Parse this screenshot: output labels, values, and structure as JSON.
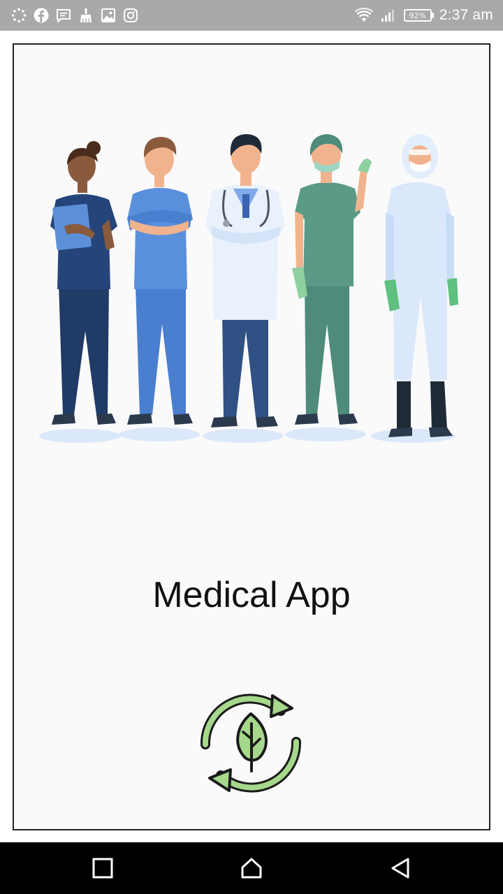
{
  "status_bar": {
    "time": "2:37 am",
    "battery_percent": "92%",
    "left_icons": [
      "sync-icon",
      "facebook-icon",
      "message-icon",
      "cleaner-icon",
      "gallery-icon",
      "instagram-icon"
    ],
    "right_icons": [
      "wifi-icon",
      "signal-icon",
      "battery-icon"
    ]
  },
  "splash": {
    "title": "Medical App",
    "illustration": "medical-staff-illustration",
    "loader_icon": "leaf-refresh-icon"
  },
  "nav_bar": {
    "buttons": [
      "recents-button",
      "home-button",
      "back-button"
    ]
  },
  "colors": {
    "status_bar_bg": "#a9a9a9",
    "content_bg": "#fafafa",
    "nav_bar_bg": "#000000",
    "loader_green": "#a6d88c"
  }
}
